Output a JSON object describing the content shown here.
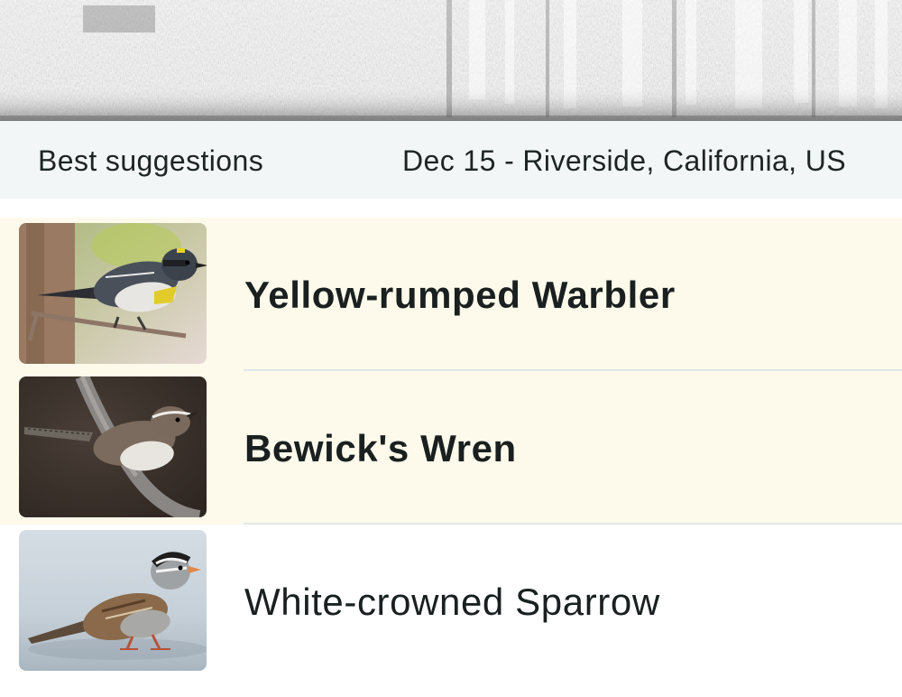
{
  "header": {
    "suggestions_label": "Best suggestions",
    "date_location": "Dec 15 - Riverside, California, US"
  },
  "suggestions": [
    {
      "name": "Yellow-rumped Warbler",
      "emphasized": true,
      "icon": "yellow-rumped-warbler-photo"
    },
    {
      "name": "Bewick's Wren",
      "emphasized": true,
      "icon": "bewicks-wren-photo"
    },
    {
      "name": "White-crowned Sparrow",
      "emphasized": false,
      "icon": "white-crowned-sparrow-photo"
    }
  ],
  "colors": {
    "highlight_row": "#fdfaeb",
    "header_bar": "#f3f6f6",
    "divider": "#e0e6e8",
    "text": "#1a2020"
  }
}
